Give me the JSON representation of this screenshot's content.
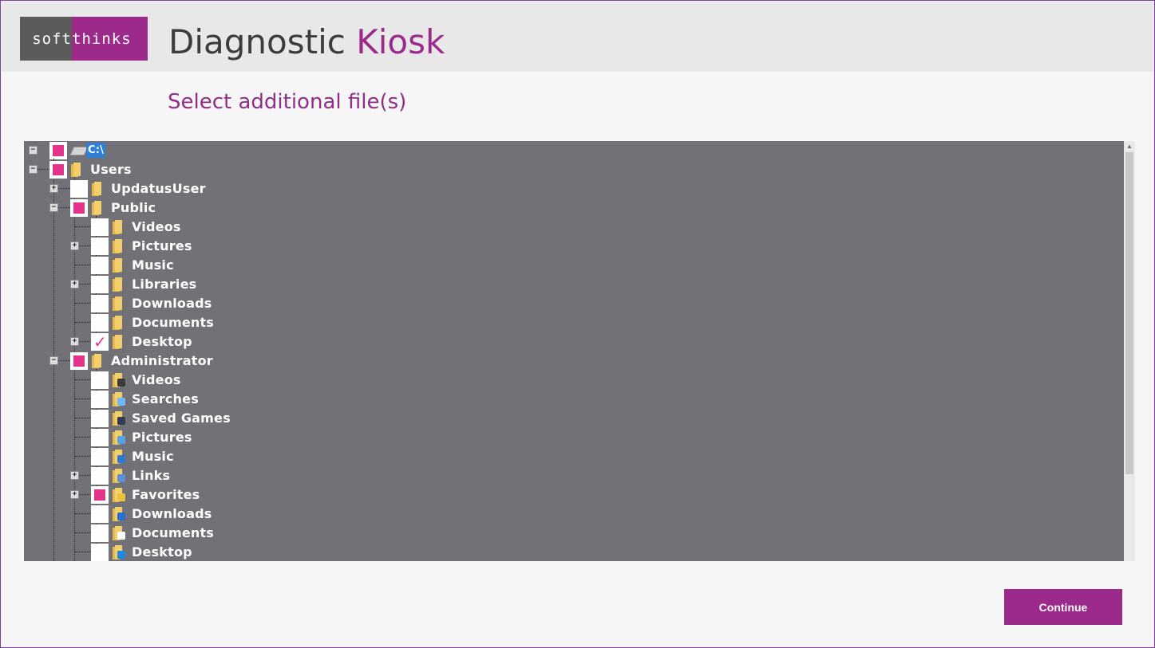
{
  "header": {
    "logo_text_a": "soft",
    "logo_text_b": "thinks",
    "title_main": "Diagnostic",
    "title_accent": "Kiosk"
  },
  "page": {
    "title": "Select additional file(s)"
  },
  "tree": {
    "root": {
      "label": "C:\\",
      "state": "partial",
      "expanded": true
    },
    "items": [
      {
        "label": "Users",
        "state": "partial",
        "expander": "minus",
        "icon": "folder-icon"
      },
      {
        "label": "UpdatusUser",
        "state": "unchecked",
        "expander": "plus",
        "icon": "folder-icon"
      },
      {
        "label": "Public",
        "state": "partial",
        "expander": "minus",
        "icon": "folder-icon"
      },
      {
        "label": "Videos",
        "state": "unchecked",
        "expander": "none",
        "icon": "folder-icon"
      },
      {
        "label": "Pictures",
        "state": "unchecked",
        "expander": "plus",
        "icon": "folder-icon"
      },
      {
        "label": "Music",
        "state": "unchecked",
        "expander": "none",
        "icon": "folder-icon"
      },
      {
        "label": "Libraries",
        "state": "unchecked",
        "expander": "plus",
        "icon": "folder-icon"
      },
      {
        "label": "Downloads",
        "state": "unchecked",
        "expander": "none",
        "icon": "folder-icon"
      },
      {
        "label": "Documents",
        "state": "unchecked",
        "expander": "none",
        "icon": "folder-icon"
      },
      {
        "label": "Desktop",
        "state": "checked",
        "expander": "plus",
        "icon": "folder-icon"
      },
      {
        "label": "Administrator",
        "state": "partial",
        "expander": "minus",
        "icon": "folder-icon"
      },
      {
        "label": "Videos",
        "state": "unchecked",
        "expander": "none",
        "icon": "videos-folder-icon"
      },
      {
        "label": "Searches",
        "state": "unchecked",
        "expander": "none",
        "icon": "searches-folder-icon"
      },
      {
        "label": "Saved Games",
        "state": "unchecked",
        "expander": "none",
        "icon": "saved-games-folder-icon"
      },
      {
        "label": "Pictures",
        "state": "unchecked",
        "expander": "none",
        "icon": "pictures-folder-icon"
      },
      {
        "label": "Music",
        "state": "unchecked",
        "expander": "none",
        "icon": "music-folder-icon"
      },
      {
        "label": "Links",
        "state": "unchecked",
        "expander": "plus",
        "icon": "links-folder-icon"
      },
      {
        "label": "Favorites",
        "state": "partial",
        "expander": "plus",
        "icon": "favorites-folder-icon"
      },
      {
        "label": "Downloads",
        "state": "unchecked",
        "expander": "none",
        "icon": "downloads-folder-icon"
      },
      {
        "label": "Documents",
        "state": "unchecked",
        "expander": "none",
        "icon": "documents-folder-icon"
      },
      {
        "label": "Desktop",
        "state": "unchecked",
        "expander": "none",
        "icon": "desktop-folder-icon"
      }
    ]
  },
  "colors": {
    "brand": "#9c2a8b",
    "check": "#e3338a",
    "tree_bg": "#727177",
    "folder": "#f3cf6b"
  },
  "actions": {
    "continue_label": "Continue"
  }
}
